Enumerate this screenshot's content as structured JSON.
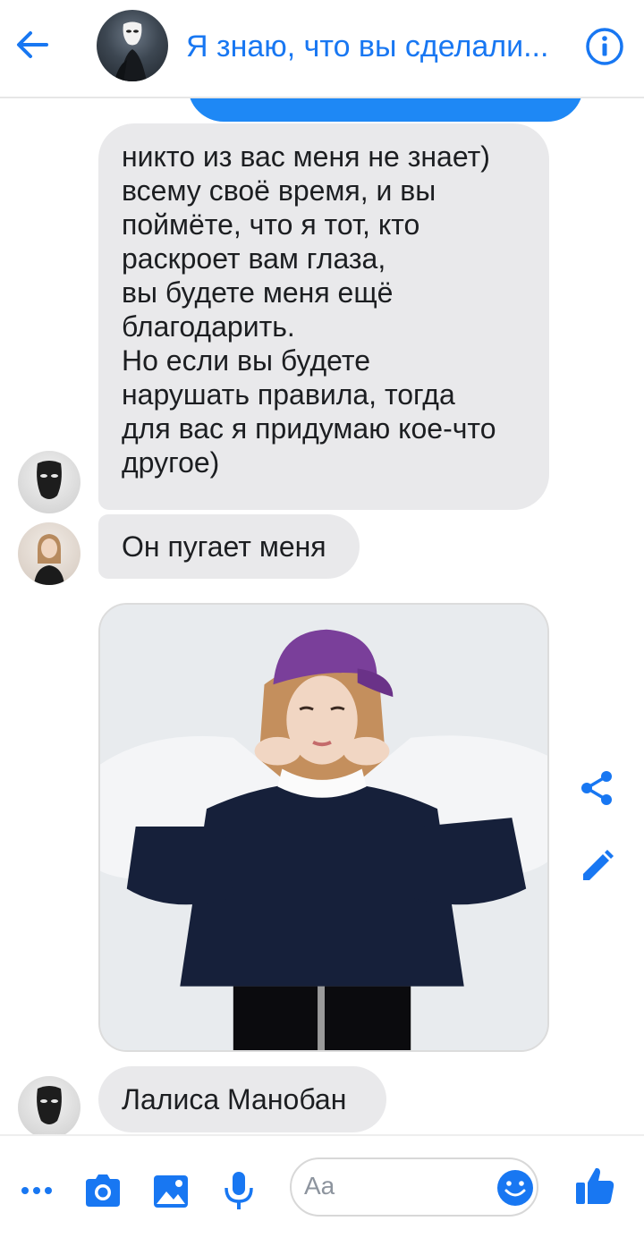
{
  "header": {
    "title": "Я знаю, что вы сделали..."
  },
  "messages": [
    {
      "text": "никто из вас меня не знает)\nвсему своё время, и вы\nпоймёте, что я тот, кто\nраскроет вам глаза,\nвы будете меня ещё\nблагодарить.\nНо если вы будете\nнарушать правила, тогда\nдля вас я придумаю кое-что\nдругое)"
    },
    {
      "text": "Он пугает меня"
    },
    {
      "text": "Лалиса Манобан"
    }
  ],
  "composer": {
    "placeholder": "Aa"
  },
  "colors": {
    "accent": "#1877f2",
    "bubble_gray": "#e9e9eb",
    "bubble_blue": "#1e88f5"
  },
  "icons": [
    "back-arrow-icon",
    "info-icon",
    "share-icon",
    "edit-icon",
    "more-icon",
    "camera-icon",
    "gallery-icon",
    "microphone-icon",
    "emoji-icon",
    "like-icon"
  ]
}
